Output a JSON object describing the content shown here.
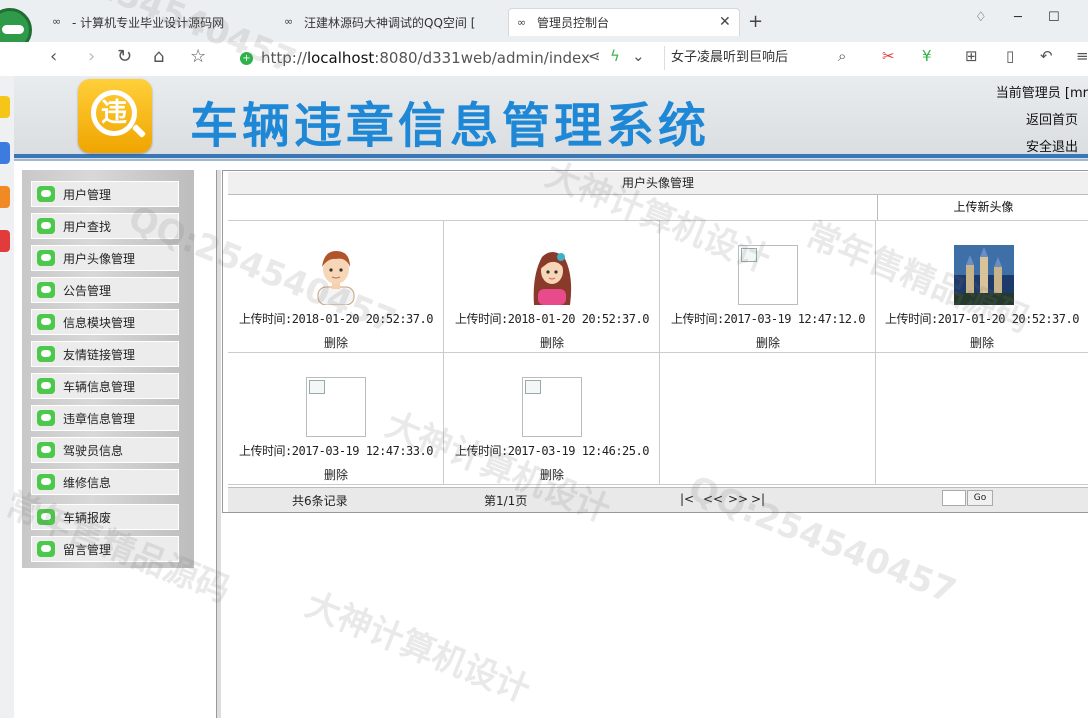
{
  "browser": {
    "tabs": [
      {
        "label": "- 计算机专业毕业设计源码网",
        "active": false
      },
      {
        "label": "汪建林源码大神调试的QQ空间 [",
        "active": false
      },
      {
        "label": "管理员控制台",
        "active": true
      }
    ],
    "new_tab": "+",
    "url_prefix": "http://",
    "url_host": "localhost",
    "url_rest": ":8080/d331web/admin/index",
    "news_text": "女子凌晨听到巨响后",
    "icons": [
      "back-icon",
      "forward-icon",
      "refresh-icon",
      "home-icon",
      "star-icon",
      "share-icon",
      "lightning-icon",
      "chevron-down-icon",
      "search-icon",
      "scissors-icon",
      "currency-icon",
      "grid-icon",
      "phone-icon",
      "undo-icon",
      "menu-icon"
    ]
  },
  "header": {
    "logo_char": "违",
    "title": "车辆违章信息管理系统",
    "current_admin": "当前管理员 [mr",
    "back_home": "返回首页",
    "logout": "安全退出",
    "accent": "#1e88d6"
  },
  "sidebar": {
    "items": [
      {
        "label": "用户管理"
      },
      {
        "label": "用户查找"
      },
      {
        "label": "用户头像管理"
      },
      {
        "label": "公告管理"
      },
      {
        "label": "信息模块管理"
      },
      {
        "label": "友情链接管理"
      },
      {
        "label": "车辆信息管理"
      },
      {
        "label": "违章信息管理"
      },
      {
        "label": "驾驶员信息"
      },
      {
        "label": "维修信息"
      },
      {
        "label": "车辆报废"
      },
      {
        "label": "留言管理"
      }
    ]
  },
  "main": {
    "title": "用户头像管理",
    "upload_link": "上传新头像",
    "avatars": [
      {
        "upload_time": "上传时间:2018-01-20 20:52:37.0",
        "delete": "删除",
        "image": "boy-avatar"
      },
      {
        "upload_time": "上传时间:2018-01-20 20:52:37.0",
        "delete": "删除",
        "image": "girl-avatar"
      },
      {
        "upload_time": "上传时间:2017-03-19 12:47:12.0",
        "delete": "删除",
        "image": "broken-image"
      },
      {
        "upload_time": "上传时间:2017-01-20 20:52:37.0",
        "delete": "删除",
        "image": "castle-image"
      },
      {
        "upload_time": "上传时间:2017-03-19 12:47:33.0",
        "delete": "删除",
        "image": "broken-image"
      },
      {
        "upload_time": "上传时间:2017-03-19 12:46:25.0",
        "delete": "删除",
        "image": "broken-image"
      }
    ],
    "pager": {
      "total": "共6条记录",
      "page": "第1/1页",
      "first": "|<",
      "prev": "<<",
      "next": ">>",
      "last": ">|",
      "go": "Go"
    }
  },
  "watermarks": [
    "QQ:254540457",
    "大神计算机设计",
    "常年售精品源码"
  ]
}
